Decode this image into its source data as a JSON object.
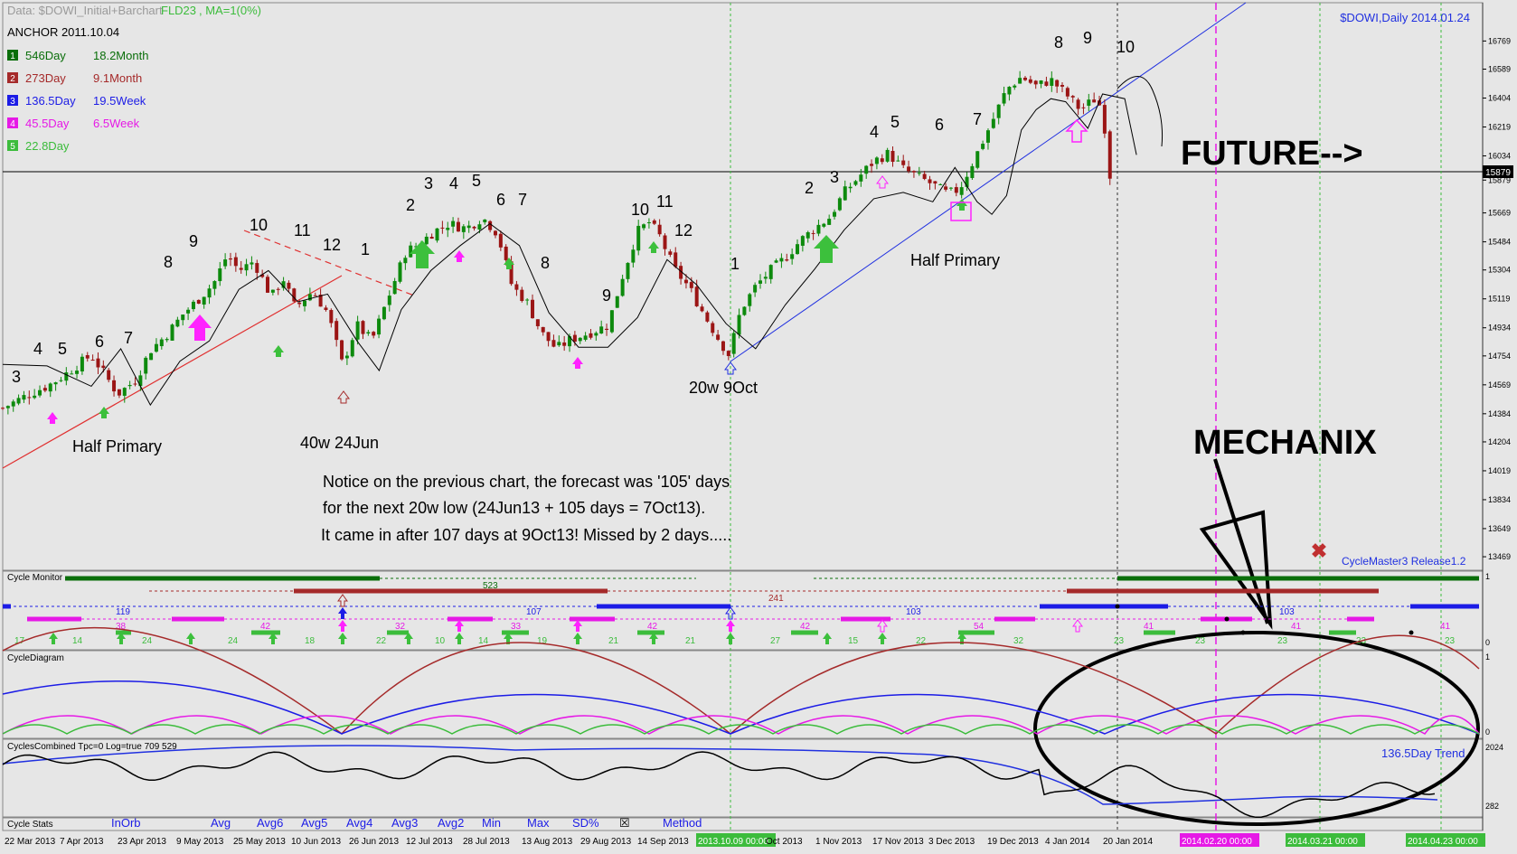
{
  "header": {
    "data_line": "Data: $DOWI_Initial+Barchart",
    "fld_label": "FLD23",
    "ma_label": ", MA=1(0%)",
    "symbol_title": "$DOWI,Daily 2014.01.24",
    "anchor": "ANCHOR 2011.10.04"
  },
  "cycles": [
    {
      "num": "1",
      "day": "546Day",
      "period": "18.2Month",
      "color": "#0a6e0a"
    },
    {
      "num": "2",
      "day": "273Day",
      "period": "9.1Month",
      "color": "#a52a2a"
    },
    {
      "num": "3",
      "day": "136.5Day",
      "period": "19.5Week",
      "color": "#1c1ce6"
    },
    {
      "num": "4",
      "day": "45.5Day",
      "period": "6.5Week",
      "color": "#e619e6"
    },
    {
      "num": "5",
      "day": "22.8Day",
      "period": "",
      "color": "#3cbc3c"
    }
  ],
  "colors": {
    "bull": "#0d8a0d",
    "bear": "#9b1515",
    "fld": "#000000",
    "trend_red": "#e03030",
    "trend_blue": "#2030e0",
    "arrow_green": "#3cc03c",
    "arrow_magenta": "#ff22ff"
  },
  "annotations": {
    "future": "FUTURE-->",
    "mechanix": "MECHANIX",
    "half_primary_1": "Half Primary",
    "half_primary_2": "Half Primary",
    "low_40w": "40w 24Jun",
    "low_20w": "20w 9Oct",
    "note_line1": "Notice on the previous chart, the forecast was '105' days",
    "note_line2": "for the next 20w low (24Jun13 + 105 days = 7Oct13).",
    "note_line3": "It came in after 107 days at 9Oct13!  Missed by 2 days.....",
    "release": "CycleMaster3 Release1.2"
  },
  "counts": [
    {
      "t": "3"
    },
    {
      "t": "4"
    },
    {
      "t": "5"
    },
    {
      "t": "6"
    },
    {
      "t": "7"
    },
    {
      "t": "8"
    },
    {
      "t": "9"
    },
    {
      "t": "10"
    },
    {
      "t": "11"
    },
    {
      "t": "12"
    },
    {
      "t": "1"
    },
    {
      "t": "2"
    },
    {
      "t": "3"
    },
    {
      "t": "4"
    },
    {
      "t": "5"
    },
    {
      "t": "6"
    },
    {
      "t": "7"
    },
    {
      "t": "8"
    },
    {
      "t": "9"
    },
    {
      "t": "10"
    },
    {
      "t": "11"
    },
    {
      "t": "12"
    },
    {
      "t": "1"
    },
    {
      "t": "2"
    },
    {
      "t": "3"
    },
    {
      "t": "4"
    },
    {
      "t": "5"
    },
    {
      "t": "6"
    },
    {
      "t": "7"
    },
    {
      "t": "8"
    },
    {
      "t": "9"
    },
    {
      "t": "10"
    }
  ],
  "panels": {
    "cycle_monitor": "Cycle Monitor",
    "cycle_diagram": "CycleDiagram",
    "cycles_combined": "CyclesCombined Tpc=0 Log=true 709 529",
    "combined_trend": "136.5Day Trend",
    "cycle_stats": "Cycle Stats"
  },
  "monitor_numbers": [
    "523",
    "241",
    "119",
    "107",
    "103",
    "103",
    "38",
    "42",
    "32",
    "33",
    "42",
    "42",
    "54",
    "41",
    "41",
    "41",
    "17",
    "14",
    "24",
    "24",
    "18",
    "22",
    "10",
    "14",
    "19",
    "21",
    "21",
    "27",
    "15",
    "22",
    "32",
    "23",
    "23",
    "23",
    "23",
    "23"
  ],
  "stats_menu": [
    "InOrb",
    "Avg",
    "Avg6",
    "Avg5",
    "Avg4",
    "Avg3",
    "Avg2",
    "Min",
    "Max",
    "SD%",
    "☒",
    "Method"
  ],
  "chart_data": {
    "type": "candlestick",
    "symbol": "$DOWI",
    "timeframe": "Daily",
    "y_ticks": [
      "16769",
      "16589",
      "16404",
      "16219",
      "16034",
      "15879",
      "15669",
      "15484",
      "15304",
      "15119",
      "14934",
      "14754",
      "14569",
      "14384",
      "14204",
      "14019",
      "13834",
      "13649",
      "13469"
    ],
    "y_range": [
      13400,
      16800
    ],
    "last_price": "15879",
    "x_ticks": [
      "22 Mar 2013",
      "7 Apr 2013",
      "23 Apr 2013",
      "9 May 2013",
      "25 May 2013",
      "10 Jun 2013",
      "26 Jun 2013",
      "12 Jul 2013",
      "28 Jul 2013",
      "13 Aug 2013",
      "29 Aug 2013",
      "14 Sep 2013",
      "2013.10.09 00:00",
      "Oct 2013",
      "1 Nov 2013",
      "17 Nov 2013",
      "3 Dec 2013",
      "19 Dec 2013",
      "4 Jan 2014",
      "20 Jan 2014",
      "2014.02.20 00:00",
      "2014.03.21 00:00",
      "2014.04.23 00:00"
    ],
    "close_path": [
      [
        0,
        14420
      ],
      [
        0.01,
        14470
      ],
      [
        0.02,
        14520
      ],
      [
        0.03,
        14560
      ],
      [
        0.04,
        14620
      ],
      [
        0.05,
        14690
      ],
      [
        0.06,
        14760
      ],
      [
        0.068,
        14650
      ],
      [
        0.078,
        14510
      ],
      [
        0.09,
        14600
      ],
      [
        0.1,
        14790
      ],
      [
        0.112,
        14900
      ],
      [
        0.122,
        15020
      ],
      [
        0.133,
        15120
      ],
      [
        0.143,
        15220
      ],
      [
        0.152,
        15400
      ],
      [
        0.16,
        15300
      ],
      [
        0.17,
        15360
      ],
      [
        0.182,
        15130
      ],
      [
        0.19,
        15250
      ],
      [
        0.198,
        15060
      ],
      [
        0.21,
        15170
      ],
      [
        0.22,
        15030
      ],
      [
        0.23,
        14700
      ],
      [
        0.24,
        14950
      ],
      [
        0.25,
        14850
      ],
      [
        0.26,
        15100
      ],
      [
        0.273,
        15420
      ],
      [
        0.282,
        15470
      ],
      [
        0.292,
        15550
      ],
      [
        0.302,
        15600
      ],
      [
        0.314,
        15570
      ],
      [
        0.325,
        15640
      ],
      [
        0.335,
        15540
      ],
      [
        0.345,
        15200
      ],
      [
        0.355,
        15100
      ],
      [
        0.365,
        14900
      ],
      [
        0.375,
        14800
      ],
      [
        0.385,
        14860
      ],
      [
        0.397,
        14900
      ],
      [
        0.41,
        14950
      ],
      [
        0.42,
        15270
      ],
      [
        0.43,
        15550
      ],
      [
        0.438,
        15610
      ],
      [
        0.445,
        15520
      ],
      [
        0.455,
        15310
      ],
      [
        0.465,
        15190
      ],
      [
        0.475,
        15020
      ],
      [
        0.485,
        14860
      ],
      [
        0.492,
        14760
      ],
      [
        0.5,
        15050
      ],
      [
        0.51,
        15200
      ],
      [
        0.52,
        15300
      ],
      [
        0.53,
        15380
      ],
      [
        0.54,
        15490
      ],
      [
        0.55,
        15570
      ],
      [
        0.56,
        15640
      ],
      [
        0.57,
        15800
      ],
      [
        0.58,
        15900
      ],
      [
        0.59,
        16000
      ],
      [
        0.6,
        16050
      ],
      [
        0.61,
        15950
      ],
      [
        0.62,
        15900
      ],
      [
        0.63,
        15850
      ],
      [
        0.64,
        15790
      ],
      [
        0.648,
        15820
      ],
      [
        0.66,
        16050
      ],
      [
        0.67,
        16250
      ],
      [
        0.68,
        16460
      ],
      [
        0.69,
        16540
      ],
      [
        0.7,
        16480
      ],
      [
        0.71,
        16520
      ],
      [
        0.72,
        16430
      ],
      [
        0.73,
        16330
      ],
      [
        0.74,
        16400
      ],
      [
        0.745,
        16330
      ],
      [
        0.75,
        15910
      ]
    ],
    "fld_path": [
      [
        0,
        14700
      ],
      [
        0.03,
        14690
      ],
      [
        0.06,
        14560
      ],
      [
        0.08,
        14800
      ],
      [
        0.1,
        14440
      ],
      [
        0.12,
        14720
      ],
      [
        0.14,
        14850
      ],
      [
        0.16,
        15180
      ],
      [
        0.18,
        15300
      ],
      [
        0.2,
        15100
      ],
      [
        0.22,
        15150
      ],
      [
        0.24,
        14850
      ],
      [
        0.255,
        14660
      ],
      [
        0.27,
        15050
      ],
      [
        0.29,
        15300
      ],
      [
        0.31,
        15460
      ],
      [
        0.33,
        15600
      ],
      [
        0.35,
        15460
      ],
      [
        0.37,
        15030
      ],
      [
        0.39,
        14810
      ],
      [
        0.41,
        14810
      ],
      [
        0.43,
        15000
      ],
      [
        0.45,
        15370
      ],
      [
        0.47,
        15210
      ],
      [
        0.49,
        14960
      ],
      [
        0.51,
        14800
      ],
      [
        0.53,
        15080
      ],
      [
        0.55,
        15310
      ],
      [
        0.57,
        15560
      ],
      [
        0.59,
        15760
      ],
      [
        0.61,
        15800
      ],
      [
        0.63,
        15740
      ],
      [
        0.645,
        15960
      ],
      [
        0.66,
        15740
      ],
      [
        0.67,
        15660
      ],
      [
        0.68,
        15780
      ],
      [
        0.69,
        16200
      ],
      [
        0.7,
        16330
      ],
      [
        0.71,
        16400
      ],
      [
        0.72,
        16380
      ],
      [
        0.735,
        16210
      ],
      [
        0.745,
        16430
      ],
      [
        0.76,
        16400
      ],
      [
        0.768,
        16040
      ]
    ]
  }
}
